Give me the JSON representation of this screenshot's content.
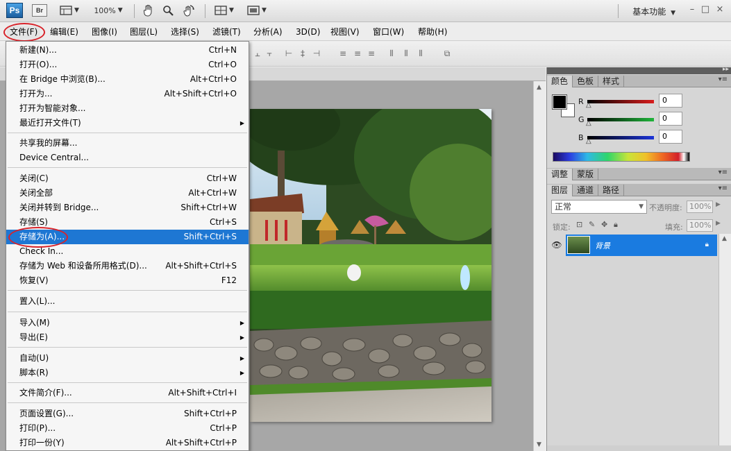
{
  "appbar": {
    "logo": "Ps",
    "bridge": "Br",
    "zoom": "100%",
    "workspace": "基本功能",
    "window_controls": [
      "–",
      "□",
      "×"
    ],
    "icons": [
      "layout-icon",
      "hand-tool-icon",
      "zoom-tool-icon",
      "rotate-view-icon",
      "arrange-documents-icon",
      "screen-mode-icon"
    ]
  },
  "menubar": {
    "items": [
      "文件(F)",
      "编辑(E)",
      "图像(I)",
      "图层(L)",
      "选择(S)",
      "滤镜(T)",
      "分析(A)",
      "3D(D)",
      "视图(V)",
      "窗口(W)",
      "帮助(H)"
    ]
  },
  "file_menu": {
    "items": [
      {
        "label": "新建(N)...",
        "shortcut": "Ctrl+N"
      },
      {
        "label": "打开(O)...",
        "shortcut": "Ctrl+O"
      },
      {
        "label": "在 Bridge 中浏览(B)...",
        "shortcut": "Alt+Ctrl+O"
      },
      {
        "label": "打开为...",
        "shortcut": "Alt+Shift+Ctrl+O"
      },
      {
        "label": "打开为智能对象...",
        "shortcut": ""
      },
      {
        "label": "最近打开文件(T)",
        "shortcut": "",
        "submenu": true
      },
      {
        "label": "共享我的屏幕...",
        "shortcut": ""
      },
      {
        "label": "Device Central...",
        "shortcut": ""
      },
      {
        "label": "关闭(C)",
        "shortcut": "Ctrl+W"
      },
      {
        "label": "关闭全部",
        "shortcut": "Alt+Ctrl+W"
      },
      {
        "label": "关闭并转到 Bridge...",
        "shortcut": "Shift+Ctrl+W"
      },
      {
        "label": "存储(S)",
        "shortcut": "Ctrl+S"
      },
      {
        "label": "存储为(A)...",
        "shortcut": "Shift+Ctrl+S",
        "highlighted": true
      },
      {
        "label": "Check In...",
        "shortcut": ""
      },
      {
        "label": "存储为 Web 和设备所用格式(D)...",
        "shortcut": "Alt+Shift+Ctrl+S"
      },
      {
        "label": "恢复(V)",
        "shortcut": "F12"
      },
      {
        "label": "置入(L)...",
        "shortcut": ""
      },
      {
        "label": "导入(M)",
        "shortcut": "",
        "submenu": true
      },
      {
        "label": "导出(E)",
        "shortcut": "",
        "submenu": true
      },
      {
        "label": "自动(U)",
        "shortcut": "",
        "submenu": true
      },
      {
        "label": "脚本(R)",
        "shortcut": "",
        "submenu": true
      },
      {
        "label": "文件简介(F)...",
        "shortcut": "Alt+Shift+Ctrl+I"
      },
      {
        "label": "页面设置(G)...",
        "shortcut": "Shift+Ctrl+P"
      },
      {
        "label": "打印(P)...",
        "shortcut": "Ctrl+P"
      },
      {
        "label": "打印一份(Y)",
        "shortcut": "Alt+Shift+Ctrl+P"
      }
    ]
  },
  "color_panel": {
    "tabs": [
      "颜色",
      "色板",
      "样式"
    ],
    "channels": [
      {
        "label": "R",
        "value": "0",
        "color": "#d81c1c"
      },
      {
        "label": "G",
        "value": "0",
        "color": "#1fb43a"
      },
      {
        "label": "B",
        "value": "0",
        "color": "#1c34d8"
      }
    ]
  },
  "adjust_panel": {
    "tabs": [
      "调整",
      "蒙版"
    ]
  },
  "layers_panel": {
    "tabs": [
      "图层",
      "通道",
      "路径"
    ],
    "blend_mode": "正常",
    "opacity_label": "不透明度:",
    "opacity_value": "100%",
    "lock_label": "锁定:",
    "fill_label": "填充:",
    "fill_value": "100%",
    "layer_name": "背景"
  },
  "colors": {
    "highlight": "#1e77d3",
    "annotation_red": "#d8232a"
  }
}
